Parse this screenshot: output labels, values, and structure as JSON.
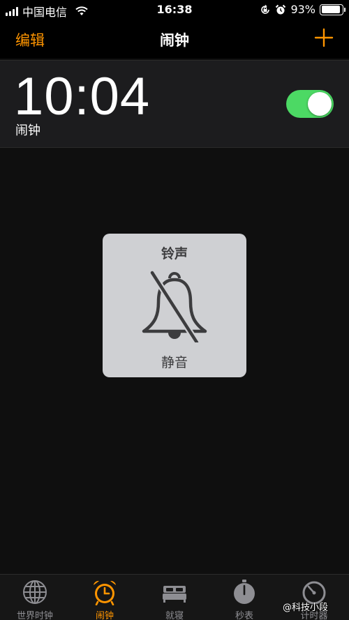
{
  "status_bar": {
    "carrier": "中国电信",
    "time": "16:38",
    "battery": "93%",
    "battery_level": 0.93
  },
  "nav": {
    "edit": "编辑",
    "title": "闹钟"
  },
  "alarm": {
    "time": "10:04",
    "label": "闹钟",
    "enabled": true
  },
  "hud": {
    "title": "铃声",
    "state": "静音"
  },
  "tabs": [
    {
      "label": "世界时钟",
      "icon": "globe-icon"
    },
    {
      "label": "闹钟",
      "icon": "alarm-clock-icon",
      "active": true
    },
    {
      "label": "就寝",
      "icon": "bed-icon"
    },
    {
      "label": "秒表",
      "icon": "stopwatch-icon"
    },
    {
      "label": "计时器",
      "icon": "timer-icon"
    }
  ],
  "watermark": "@科技小段",
  "colors": {
    "accent": "#ff9500",
    "toggle_on": "#4cd964",
    "row_bg": "#1c1c1e"
  }
}
